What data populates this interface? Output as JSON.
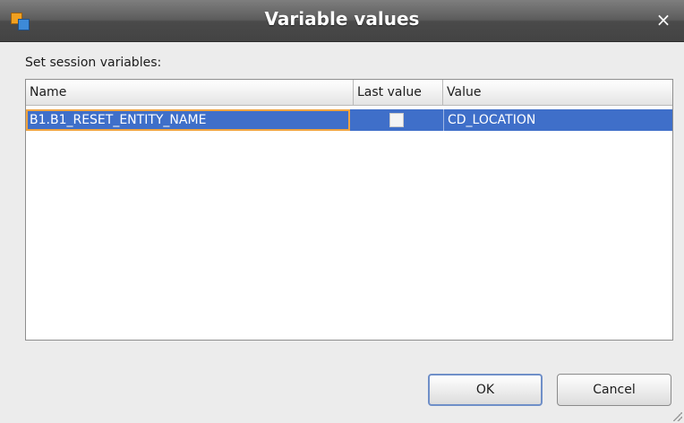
{
  "window": {
    "title": "Variable values",
    "close_symbol": "×",
    "icon": "app-icon"
  },
  "prompt": "Set session variables:",
  "table": {
    "columns": [
      "Name",
      "Last value",
      "Value"
    ],
    "rows": [
      {
        "name": "B1.B1_RESET_ENTITY_NAME",
        "last_value_checked": false,
        "value": "CD_LOCATION",
        "selected": true
      }
    ]
  },
  "buttons": {
    "ok": "OK",
    "cancel": "Cancel"
  },
  "colors": {
    "selection": "#3f6fc9",
    "focus_border": "#f0a440",
    "titlebar": "#4a4a4a"
  }
}
